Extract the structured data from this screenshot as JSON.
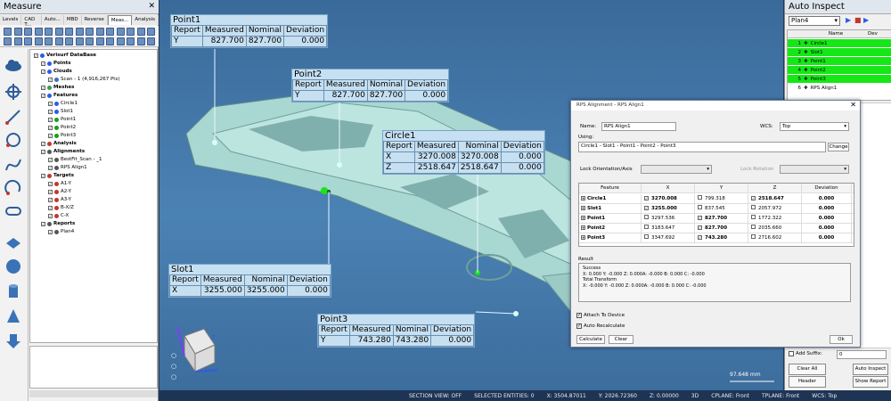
{
  "measure": {
    "title": "Measure",
    "tabs": [
      "Levels",
      "CAD T...",
      "Auto...",
      "MBD",
      "Reverse",
      "Meas...",
      "Analysis"
    ],
    "tree": [
      {
        "t": "Verisurf DataBase",
        "b": true
      },
      {
        "t": "Points",
        "b": true
      },
      {
        "t": "Clouds",
        "b": true
      },
      {
        "t": "Scan - 1 (4,916,267 Pts)"
      },
      {
        "t": "Meshes",
        "b": true
      },
      {
        "t": "Features",
        "b": true
      },
      {
        "t": "Circle1"
      },
      {
        "t": "Slot1"
      },
      {
        "t": "Point1"
      },
      {
        "t": "Point2"
      },
      {
        "t": "Point3"
      },
      {
        "t": "Analysis",
        "b": true
      },
      {
        "t": "Alignments",
        "b": true
      },
      {
        "t": "BestFit_Scan - _1"
      },
      {
        "t": "RPS Align1"
      },
      {
        "t": "Targets",
        "b": true
      },
      {
        "t": "A1-Y"
      },
      {
        "t": "A2-Y"
      },
      {
        "t": "A3-Y"
      },
      {
        "t": "B-X/Z"
      },
      {
        "t": "C-X"
      },
      {
        "t": "Reports",
        "b": true
      },
      {
        "t": "Plan4"
      }
    ]
  },
  "labels": {
    "point1": {
      "title": "Point1",
      "head": [
        "Report",
        "Measured",
        "Nominal",
        "Deviation"
      ],
      "row": [
        "Y",
        "827.700",
        "827.700",
        "0.000"
      ]
    },
    "point2": {
      "title": "Point2",
      "head": [
        "Report",
        "Measured",
        "Nominal",
        "Deviation"
      ],
      "row": [
        "Y",
        "827.700",
        "827.700",
        "0.000"
      ]
    },
    "circle1": {
      "title": "Circle1",
      "head": [
        "Report",
        "Measured",
        "Nominal",
        "Deviation"
      ],
      "rows": [
        [
          "X",
          "3270.008",
          "3270.008",
          "0.000"
        ],
        [
          "Z",
          "2518.647",
          "2518.647",
          "0.000"
        ]
      ]
    },
    "slot1": {
      "title": "Slot1",
      "head": [
        "Report",
        "Measured",
        "Nominal",
        "Deviation"
      ],
      "row": [
        "X",
        "3255.000",
        "3255.000",
        "0.000"
      ]
    },
    "point3": {
      "title": "Point3",
      "head": [
        "Report",
        "Measured",
        "Nominal",
        "Deviation"
      ],
      "row": [
        "Y",
        "743.280",
        "743.280",
        "0.000"
      ]
    }
  },
  "scale_label": "97.648 mm",
  "status": {
    "section": "SECTION VIEW: OFF",
    "selected": "SELECTED ENTITIES: 0",
    "x": "X:   3504.87011",
    "y": "Y:   2026.72360",
    "z": "Z:   0.00000",
    "mode": "3D",
    "cplane": "CPLANE: Front",
    "tplane": "TPLANE: Front",
    "wcs": "WCS: Top"
  },
  "auto": {
    "title": "Auto Inspect",
    "plan": "Plan4",
    "col_name": "Name",
    "col_dev": "Dev",
    "rows": [
      {
        "n": "1",
        "name": "Circle1"
      },
      {
        "n": "2",
        "name": "Slot1"
      },
      {
        "n": "3",
        "name": "Point1"
      },
      {
        "n": "4",
        "name": "Point2"
      },
      {
        "n": "5",
        "name": "Point3"
      },
      {
        "n": "6",
        "name": "RPS Align1"
      }
    ],
    "add_suffix": "Add Suffix:",
    "suffix_val": "0",
    "clear_all": "Clear All",
    "auto_inspect": "Auto Inspect",
    "header": "Header",
    "show_report": "Show Report"
  },
  "dialog": {
    "title": "RPS Alignment - RPS Align1",
    "name_label": "Name:",
    "name_val": "RPS Align1",
    "wcs_label": "WCS:",
    "wcs_val": "Top",
    "using_label": "Using:",
    "using_val": "Circle1 - Slot1 - Point1 - Point2 - Point3",
    "change": "Change",
    "lock_orient": "Lock Orientation/Axis",
    "lock_rot": "Lock Rotation",
    "cols": [
      "Feature",
      "X",
      "Y",
      "Z",
      "Deviation"
    ],
    "rows": [
      {
        "f": "Circle1",
        "x": "3270.008",
        "y": "799.318",
        "z": "2518.647",
        "d": "0.000",
        "xb": true,
        "yb": false,
        "zb": true
      },
      {
        "f": "Slot1",
        "x": "3255.000",
        "y": "837.545",
        "z": "2057.972",
        "d": "0.000",
        "xb": true,
        "yb": false,
        "zb": false
      },
      {
        "f": "Point1",
        "x": "3297.536",
        "y": "827.700",
        "z": "1772.322",
        "d": "0.000",
        "xb": false,
        "yb": true,
        "zb": false
      },
      {
        "f": "Point2",
        "x": "3183.647",
        "y": "827.700",
        "z": "2035.660",
        "d": "0.000",
        "xb": false,
        "yb": true,
        "zb": false
      },
      {
        "f": "Point3",
        "x": "3347.692",
        "y": "743.280",
        "z": "2716.602",
        "d": "0.000",
        "xb": false,
        "yb": true,
        "zb": false
      }
    ],
    "result_label": "Result",
    "result_lines": [
      "Success",
      "X: 0.000 Y: -0.000 Z: 0.000A: -0.000 B: 0.000 C: -0.000",
      "Total Transform",
      "X: -0.000 Y: -0.000 Z: 0.000A: -0.000 B: 0.000 C: -0.000"
    ],
    "attach": "Attach To Device",
    "auto_recalc": "Auto Recalculate",
    "calculate": "Calculate",
    "clear": "Clear",
    "ok": "Ok"
  },
  "colors": {
    "highlight": "#16e716",
    "label_bg": "#c6e0f2",
    "part": "#a9d7d2"
  }
}
